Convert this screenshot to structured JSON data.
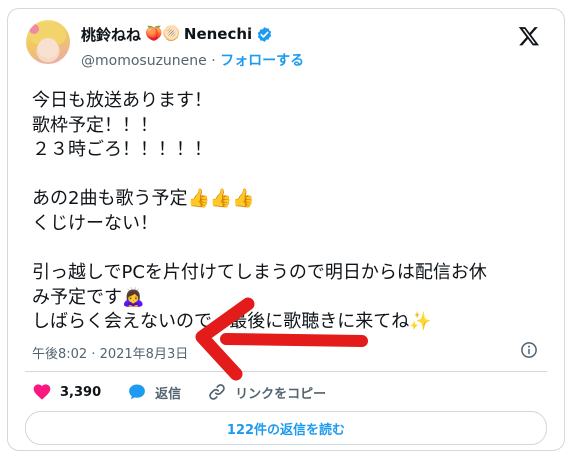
{
  "author": {
    "display_name": "桃鈴ねね",
    "name_emojis": "🍑🫓",
    "name_suffix": "Nenechi",
    "handle": "@momosuzunene",
    "separator": " · ",
    "follow_label": "フォローする"
  },
  "tweet": {
    "lines": [
      "今日も放送あります！",
      "歌枠予定！！！",
      "２３時ごろ！！！！！",
      "",
      "あの2曲も歌う予定👍👍👍",
      "くじけーない！",
      "",
      "引っ越しでPCを片付けてしまうので明日からは配信お休",
      "み予定です🙇‍♀️",
      "しばらく会えないので、最後に歌聴きに来てね✨"
    ],
    "timestamp": "午後8:02 · 2021年8月3日"
  },
  "actions": {
    "like_count": "3,390",
    "reply_label": "返信",
    "copy_link_label": "リンクをコピー"
  },
  "replies_button_label": "122件の返信を読む",
  "colors": {
    "accent": "#1d9bf0",
    "like": "#f91880",
    "text": "#0f1419",
    "muted": "#536471",
    "border": "#cfd9de",
    "annotation_arrow": "#e31b1b"
  },
  "icons": {
    "verified": "verified-badge-icon",
    "x_logo": "x-logo-icon",
    "info": "info-icon",
    "like": "heart-icon",
    "reply": "speech-bubble-icon",
    "link": "link-icon"
  }
}
